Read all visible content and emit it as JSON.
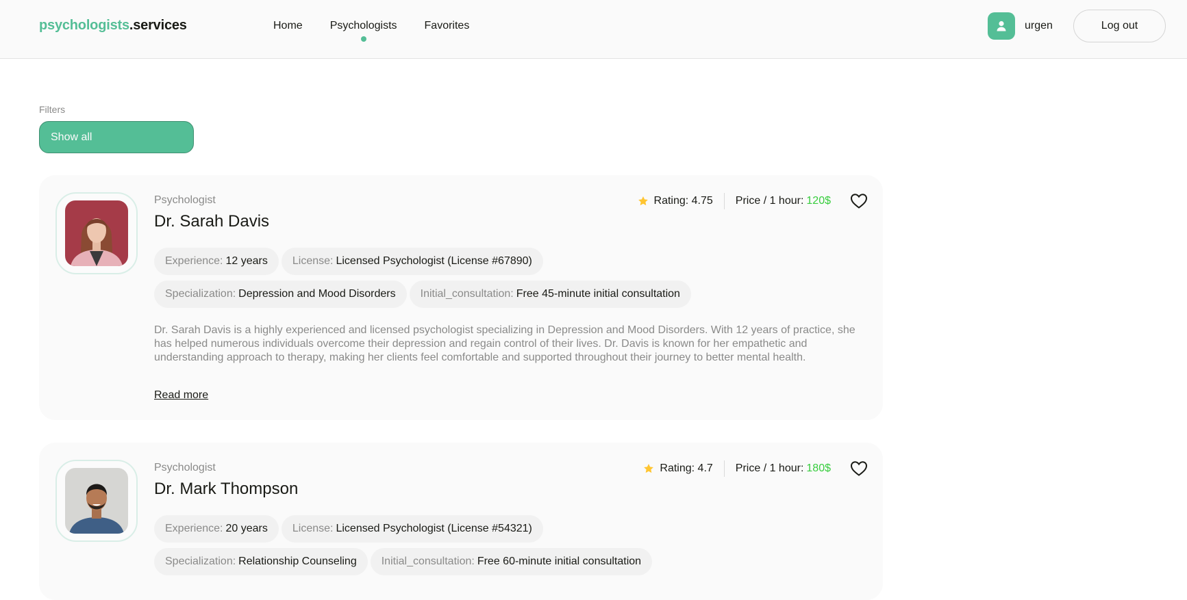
{
  "header": {
    "logo_accent": "psychologists",
    "logo_rest": ".services",
    "nav": [
      "Home",
      "Psychologists",
      "Favorites"
    ],
    "active_nav": "Psychologists",
    "user_name": "urgen",
    "logout_label": "Log out"
  },
  "filters": {
    "label": "Filters",
    "selected": "Show all"
  },
  "colors": {
    "accent": "#54be96",
    "price": "#38cd3e",
    "star": "#ffc531"
  },
  "psychologists": [
    {
      "role": "Psychologist",
      "name": "Dr. Sarah Davis",
      "rating_label": "Rating: 4.75",
      "price_label": "Price / 1 hour:",
      "price": "120$",
      "experience_key": "Experience:",
      "experience": "12 years",
      "license_key": "License:",
      "license": "Licensed Psychologist (License #67890)",
      "specialization_key": "Specialization:",
      "specialization": "Depression and Mood Disorders",
      "consultation_key": "Initial_consultation:",
      "consultation": "Free 45-minute initial consultation",
      "about": "Dr. Sarah Davis is a highly experienced and licensed psychologist specializing in Depression and Mood Disorders. With 12 years of practice, she has helped numerous individuals overcome their depression and regain control of their lives. Dr. Davis is known for her empathetic and understanding approach to therapy, making her clients feel comfortable and supported throughout their journey to better mental health.",
      "read_more": "Read more"
    },
    {
      "role": "Psychologist",
      "name": "Dr. Mark Thompson",
      "rating_label": "Rating: 4.7",
      "price_label": "Price / 1 hour:",
      "price": "180$",
      "experience_key": "Experience:",
      "experience": "20 years",
      "license_key": "License:",
      "license": "Licensed Psychologist (License #54321)",
      "specialization_key": "Specialization:",
      "specialization": "Relationship Counseling",
      "consultation_key": "Initial_consultation:",
      "consultation": "Free 60-minute initial consultation"
    }
  ]
}
